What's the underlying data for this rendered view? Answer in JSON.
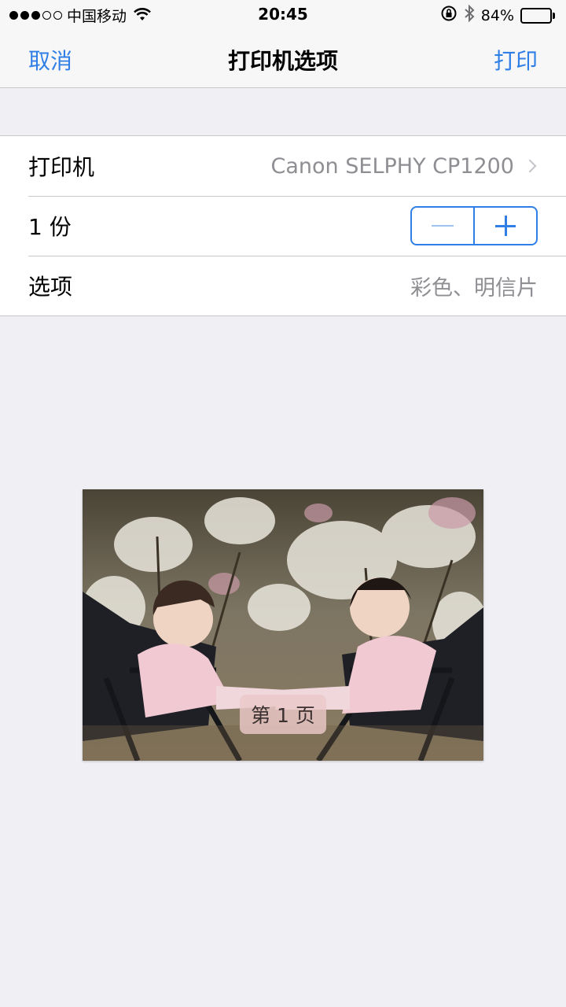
{
  "status_bar": {
    "carrier": "中国移动",
    "time": "20:45",
    "battery_percent": "84%",
    "battery_level": 0.84,
    "icons": [
      "signal-dots",
      "wifi-icon",
      "orientation-lock-icon",
      "bluetooth-icon",
      "battery-icon"
    ]
  },
  "nav": {
    "cancel_label": "取消",
    "title": "打印机选项",
    "print_label": "打印"
  },
  "settings": {
    "printer_label": "打印机",
    "printer_value": "Canon SELPHY CP1200",
    "copies_label": "1 份",
    "options_label": "选项",
    "options_value": "彩色、明信片"
  },
  "preview": {
    "page_label": "第 1 页"
  },
  "colors": {
    "accent": "#2f7fe6",
    "background": "#efeff4",
    "secondary_text": "#8e8e93"
  }
}
